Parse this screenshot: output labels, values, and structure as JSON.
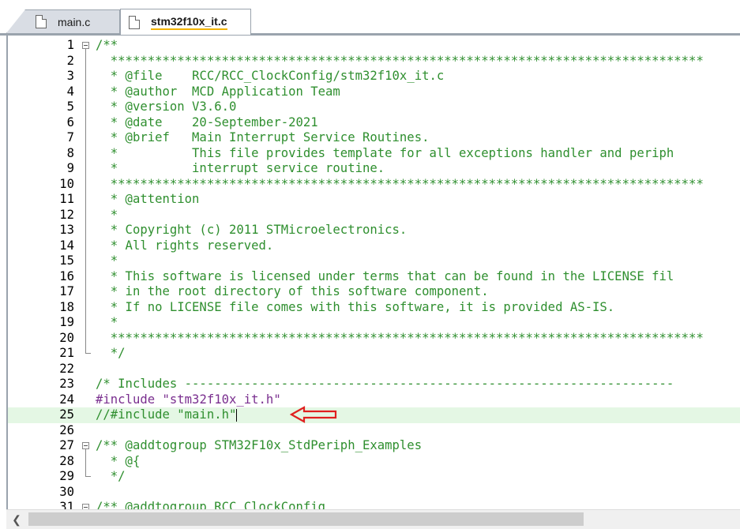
{
  "tabs": [
    {
      "label": "main.c",
      "active": false
    },
    {
      "label": "stm32f10x_it.c",
      "active": true
    }
  ],
  "lines": [
    {
      "n": "1",
      "parts": [
        {
          "t": "/**",
          "c": "comment"
        }
      ],
      "fold": "open"
    },
    {
      "n": "2",
      "parts": [
        {
          "t": "  ********************************************************************************",
          "c": "comment"
        }
      ]
    },
    {
      "n": "3",
      "parts": [
        {
          "t": "  * @file    ",
          "c": "comment"
        },
        {
          "t": "RCC/RCC_ClockConfig/stm32f10x_it.c",
          "c": "comment"
        }
      ]
    },
    {
      "n": "4",
      "parts": [
        {
          "t": "  * @author  MCD Application Team",
          "c": "comment"
        }
      ]
    },
    {
      "n": "5",
      "parts": [
        {
          "t": "  * @version V3.6.0",
          "c": "comment"
        }
      ]
    },
    {
      "n": "6",
      "parts": [
        {
          "t": "  * @date    20-September-2021",
          "c": "comment"
        }
      ]
    },
    {
      "n": "7",
      "parts": [
        {
          "t": "  * @brief   Main Interrupt Service Routines.",
          "c": "comment"
        }
      ]
    },
    {
      "n": "8",
      "parts": [
        {
          "t": "  *          This file provides template for all exceptions handler and periph",
          "c": "comment"
        }
      ]
    },
    {
      "n": "9",
      "parts": [
        {
          "t": "  *          interrupt service routine.",
          "c": "comment"
        }
      ]
    },
    {
      "n": "10",
      "parts": [
        {
          "t": "  ********************************************************************************",
          "c": "comment"
        }
      ]
    },
    {
      "n": "11",
      "parts": [
        {
          "t": "  * @attention",
          "c": "comment"
        }
      ]
    },
    {
      "n": "12",
      "parts": [
        {
          "t": "  *",
          "c": "comment"
        }
      ]
    },
    {
      "n": "13",
      "parts": [
        {
          "t": "  * Copyright (c) 2011 STMicroelectronics.",
          "c": "comment"
        }
      ]
    },
    {
      "n": "14",
      "parts": [
        {
          "t": "  * All rights reserved.",
          "c": "comment"
        }
      ]
    },
    {
      "n": "15",
      "parts": [
        {
          "t": "  *",
          "c": "comment"
        }
      ]
    },
    {
      "n": "16",
      "parts": [
        {
          "t": "  * This software is licensed under terms that can be found in the LICENSE fil",
          "c": "comment"
        }
      ]
    },
    {
      "n": "17",
      "parts": [
        {
          "t": "  * in the root directory of this software component.",
          "c": "comment"
        }
      ]
    },
    {
      "n": "18",
      "parts": [
        {
          "t": "  * If no LICENSE file comes with this software, it is provided AS-IS.",
          "c": "comment"
        }
      ]
    },
    {
      "n": "19",
      "parts": [
        {
          "t": "  *",
          "c": "comment"
        }
      ]
    },
    {
      "n": "20",
      "parts": [
        {
          "t": "  ********************************************************************************",
          "c": "comment"
        }
      ]
    },
    {
      "n": "21",
      "parts": [
        {
          "t": "  */",
          "c": "comment"
        }
      ],
      "fold": "end"
    },
    {
      "n": "22",
      "parts": []
    },
    {
      "n": "23",
      "parts": [
        {
          "t": "/* Includes ------------------------------------------------------------------",
          "c": "comment"
        }
      ]
    },
    {
      "n": "24",
      "parts": [
        {
          "t": "#include ",
          "c": "pre"
        },
        {
          "t": "\"stm32f10x_it.h\"",
          "c": "str"
        }
      ]
    },
    {
      "n": "25",
      "parts": [
        {
          "t": "//#include \"main.h\"",
          "c": "comment"
        }
      ],
      "highlight": true,
      "cursor": true
    },
    {
      "n": "26",
      "parts": []
    },
    {
      "n": "27",
      "parts": [
        {
          "t": "/** @addtogroup STM32F10x_StdPeriph_Examples",
          "c": "comment"
        }
      ],
      "fold": "open"
    },
    {
      "n": "28",
      "parts": [
        {
          "t": "  * @{",
          "c": "comment"
        }
      ]
    },
    {
      "n": "29",
      "parts": [
        {
          "t": "  */",
          "c": "comment"
        }
      ],
      "fold": "end"
    },
    {
      "n": "30",
      "parts": []
    },
    {
      "n": "31",
      "parts": [
        {
          "t": "/** @addtogroup RCC_ClockConfig",
          "c": "comment"
        }
      ],
      "fold": "open"
    }
  ],
  "annotation": {
    "icon": "left-arrow-icon",
    "color": "#e02020"
  },
  "colors": {
    "comment": "#2f8f2f",
    "preprocessor": "#7a2f8f",
    "highlight": "#e4f7e4",
    "tab_underline": "#f2b300"
  }
}
